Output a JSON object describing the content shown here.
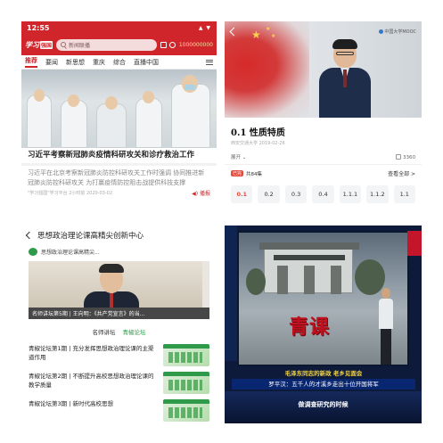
{
  "panel1": {
    "status_time": "12:55",
    "status_icons": "▲ ▼",
    "logo_text": "学习",
    "logo_box": "强国",
    "search_placeholder": "新闻联播",
    "score_text": "1000000000",
    "tabs": [
      "推荐",
      "要闻",
      "新思想",
      "重庆",
      "综合",
      "直播中国"
    ],
    "headline": "习近平考察新冠肺炎疫情科研攻关和诊疗救治工作",
    "summary": "习近平在北京考察新冠肺炎防控科研攻关工作时强调  协同推进新冠肺炎防控科研攻关 为打赢疫情防控阻击战提供科技支撑",
    "meta": "\"学习强国\"学习平台  2小时前  2020-03-02",
    "play_label": "播报"
  },
  "panel2": {
    "brand": "中国大学MOOC",
    "course_title": "0.1 性质特质",
    "course_sub": "西安交通大学   2019-02-26",
    "expand_label": "展开",
    "likes": "3360",
    "list_badge": "已完",
    "list_count": "共84集",
    "view_all": "查看全部 >",
    "episodes": [
      "0.1",
      "0.2",
      "0.3",
      "0.4",
      "1.1.1",
      "1.1.2",
      "1.1"
    ]
  },
  "panel3": {
    "page_title": "思想政治理论课高精尖创新中心",
    "channel_name": "思想政治理论课高精尖...",
    "feature_caption": "名师讲坛第5期 | 王向明：《共产党宣言》的当...",
    "tabs": [
      "名师讲坛",
      "青椒论坛"
    ],
    "items": [
      "青椒论坛第1期 | 充分发挥思想政治理论课的主渠道作用",
      "青椒论坛第2期 | 不断提升高校思想政治理论课的教学质量",
      "青椒论坛第3期 | 新时代高校思想"
    ]
  },
  "panel4": {
    "stage_sign": "青课",
    "ticker_top": "毛泽东同志的新政 老乡见面会",
    "ticker_bottom": "罗平汉：五千人的才溪乡走出十位开国将军",
    "caption": "做调查研究的时候"
  },
  "colors": {
    "app_red": "#d0262b",
    "mooc_accent": "#e64a3b",
    "green_accent": "#2e9a4a",
    "tv_navy": "#0d1a3a"
  }
}
